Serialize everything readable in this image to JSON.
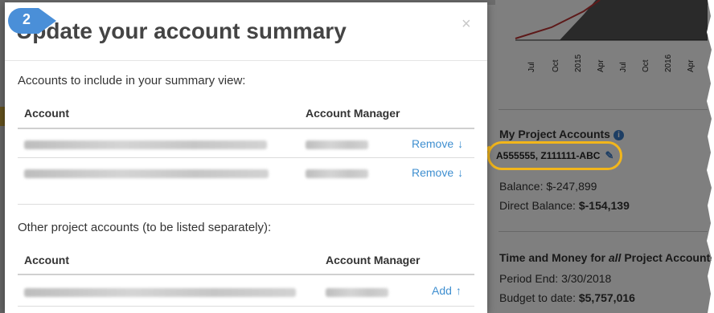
{
  "step_number": "2",
  "modal": {
    "title": "Update your account summary",
    "close_glyph": "×",
    "included_section": {
      "label": "Accounts to include in your summary view:",
      "col_account": "Account",
      "col_manager": "Account Manager",
      "rows": [
        {
          "action": "Remove",
          "action_icon": "arrow-down-icon",
          "arrow": "↓"
        },
        {
          "action": "Remove",
          "action_icon": "arrow-down-icon",
          "arrow": "↓"
        }
      ]
    },
    "other_section": {
      "label": "Other project accounts (to be listed separately):",
      "col_account": "Account",
      "col_manager": "Account Manager",
      "rows": [
        {
          "action": "Add",
          "action_icon": "arrow-up-icon",
          "arrow": "↑"
        }
      ]
    }
  },
  "background": {
    "chart_ticks": [
      "Jul",
      "Oct",
      "2015",
      "Apr",
      "Jul",
      "Oct",
      "2016",
      "Apr"
    ],
    "my_project_accounts": {
      "heading": "My Project Accounts",
      "account_ids": "A555555, Z111111-ABC",
      "balance_label": "Balance:",
      "balance_value": "$-247,899",
      "direct_balance_label": "Direct Balance:",
      "direct_balance_value": "$-154,139"
    },
    "time_money": {
      "heading_prefix": "Time and Money for ",
      "heading_emph": "all",
      "heading_suffix": " Project Accounts",
      "period_end_label": "Period End:",
      "period_end_value": "3/30/2018",
      "budget_label": "Budget to date:",
      "budget_value": "$5,757,016"
    }
  },
  "colors": {
    "link_blue": "#3f8fd0",
    "highlight_orange": "#f2b61b",
    "badge_blue": "#4a8fd8"
  }
}
